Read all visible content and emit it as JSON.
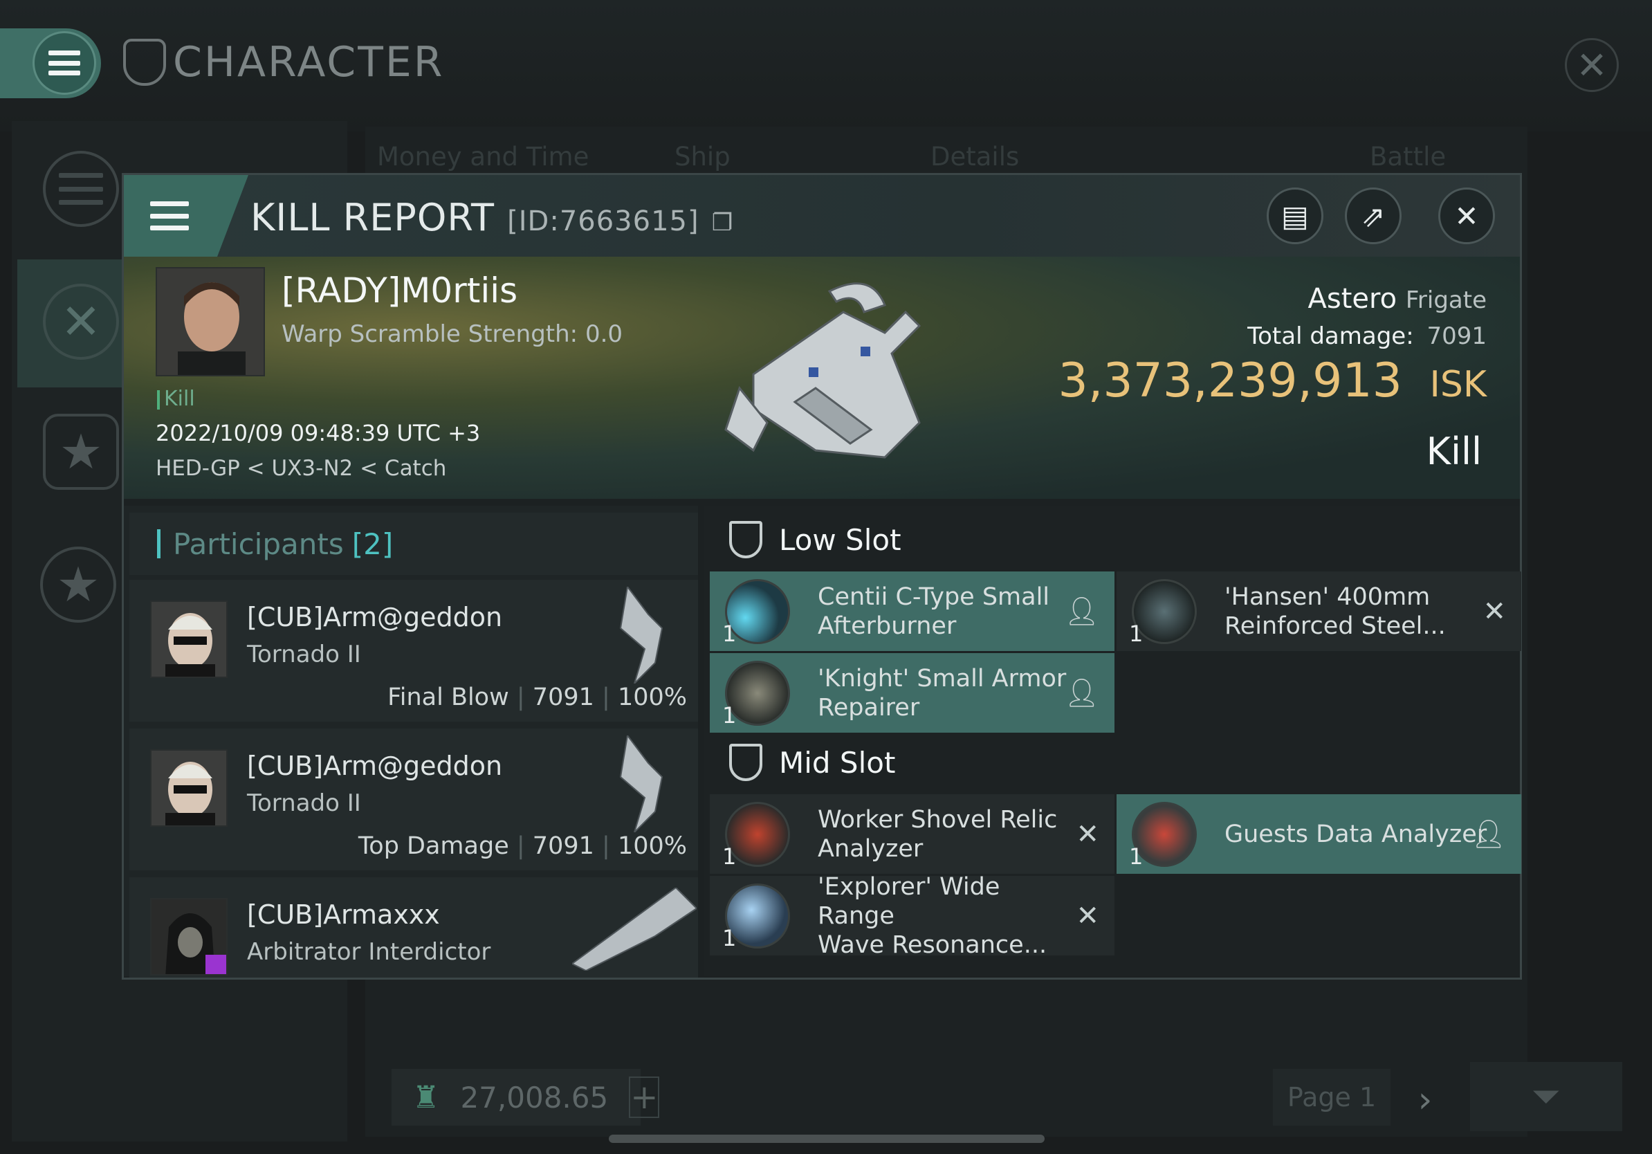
{
  "app": {
    "title": "CHARACTER"
  },
  "background": {
    "tabs": [
      "Money and Time",
      "Ship",
      "Details",
      "Battle Status"
    ],
    "bottom_value": "27,008.65",
    "page_label": "Page 1"
  },
  "modal": {
    "title": "KILL REPORT",
    "id_label": "[ID:7663615]"
  },
  "victim": {
    "name": "[RADY]M0rtiis",
    "warp_scramble": "Warp Scramble Strength: 0.0",
    "tag": "Kill",
    "datetime": "2022/10/09 09:48:39 UTC +3",
    "location": "HED-GP < UX3-N2 < Catch",
    "ship_name": "Astero",
    "ship_class": "Frigate",
    "total_damage_label": "Total damage:",
    "total_damage": "7091",
    "isk_value": "3,373,239,913",
    "isk_unit": "ISK",
    "result": "Kill"
  },
  "participants": {
    "label": "Participants",
    "count": "[2]",
    "rows": [
      {
        "name": "[CUB]Arm@geddon",
        "ship": "Tornado II",
        "role": "Final Blow",
        "damage": "7091",
        "percent": "100%"
      },
      {
        "name": "[CUB]Arm@geddon",
        "ship": "Tornado II",
        "role": "Top Damage",
        "damage": "7091",
        "percent": "100%"
      },
      {
        "name": "[CUB]Armaxxx",
        "ship": "Arbitrator Interdictor"
      }
    ]
  },
  "slots": {
    "low": {
      "title": "Low Slot",
      "items": [
        {
          "name_l1": "Centii C-Type Small",
          "name_l2": "Afterburner",
          "qty": "1",
          "status": "dropped"
        },
        {
          "name_l1": "'Hansen' 400mm",
          "name_l2": "Reinforced Steel...",
          "qty": "1",
          "status": "destroyed"
        },
        {
          "name_l1": "'Knight' Small Armor",
          "name_l2": "Repairer",
          "qty": "1",
          "status": "dropped"
        }
      ]
    },
    "mid": {
      "title": "Mid Slot",
      "items": [
        {
          "name_l1": "Worker Shovel Relic",
          "name_l2": "Analyzer",
          "qty": "1",
          "status": "destroyed"
        },
        {
          "name_l1": "Guests Data Analyzer",
          "name_l2": "",
          "qty": "1",
          "status": "dropped"
        },
        {
          "name_l1": "'Explorer' Wide Range",
          "name_l2": "Wave Resonance...",
          "qty": "1",
          "status": "destroyed"
        }
      ]
    }
  },
  "colors": {
    "accent": "#3f6c66",
    "isk": "#e8c27a",
    "participants": "#5d8a86"
  }
}
